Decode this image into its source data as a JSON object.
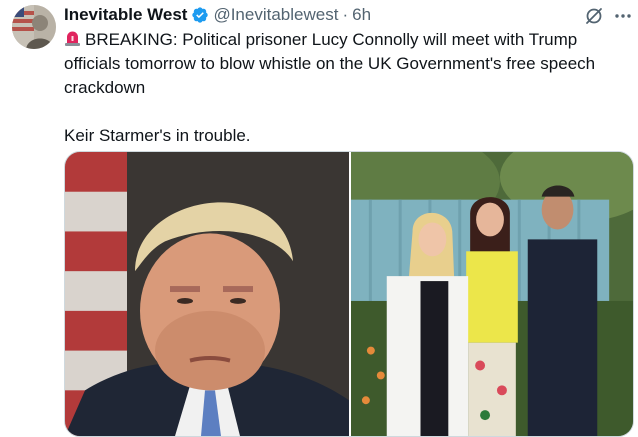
{
  "tweet": {
    "author": {
      "display_name": "Inevitable West",
      "handle": "@Inevitablewest",
      "verified": true,
      "avatar_icon": "avatar-flag-portrait"
    },
    "separator": "·",
    "timestamp": "6h",
    "text_line_1": "BREAKING: Political prisoner Lucy Connolly will meet with Trump officials tomorrow to blow whistle on the UK Government's free speech crackdown",
    "text_line_2": "Keir Starmer's in trouble.",
    "leading_emoji": "rotating-light-emoji",
    "media": [
      {
        "kind": "photo",
        "icon": "portrait-photo"
      },
      {
        "kind": "photo",
        "icon": "group-photo"
      }
    ],
    "actions": {
      "grok_icon": "grok-icon",
      "more_icon": "more-icon"
    }
  },
  "colors": {
    "text_primary": "#0f1419",
    "text_secondary": "#536471",
    "verified_blue": "#1d9bf0",
    "border": "#cfd9de"
  }
}
